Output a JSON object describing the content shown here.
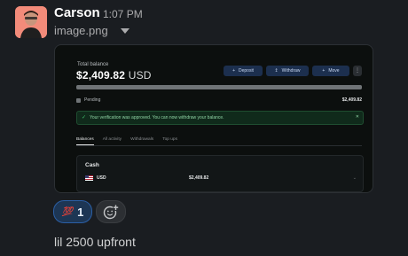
{
  "message": {
    "author": "Carson",
    "time": "1:07 PM",
    "file_name": "image.png",
    "text": "lil 2500 upfront"
  },
  "screenshot": {
    "total_balance_label": "Total balance",
    "amount": "$2,409.82",
    "currency": "USD",
    "buttons": {
      "deposit": "Deposit",
      "withdraw": "Withdraw",
      "move": "Move",
      "more": "⋮"
    },
    "balance_bar_fill_percent": 100,
    "pending_label": "Pending",
    "pending_amount": "$2,409.82",
    "alert_message": "Your verification was approved. You can now withdraw your balance.",
    "tabs": [
      "Balances",
      "All activity",
      "Withdrawals",
      "Top ups"
    ],
    "card_title": "Cash",
    "row_currency": "USD",
    "row_amount": "$2,409.82"
  },
  "reactions": [
    {
      "emoji": "💯",
      "count": "1"
    }
  ],
  "colors": {
    "background": "#1a1d21",
    "reaction_active": "#1d3654",
    "alert_green": "#3fbf6b"
  }
}
